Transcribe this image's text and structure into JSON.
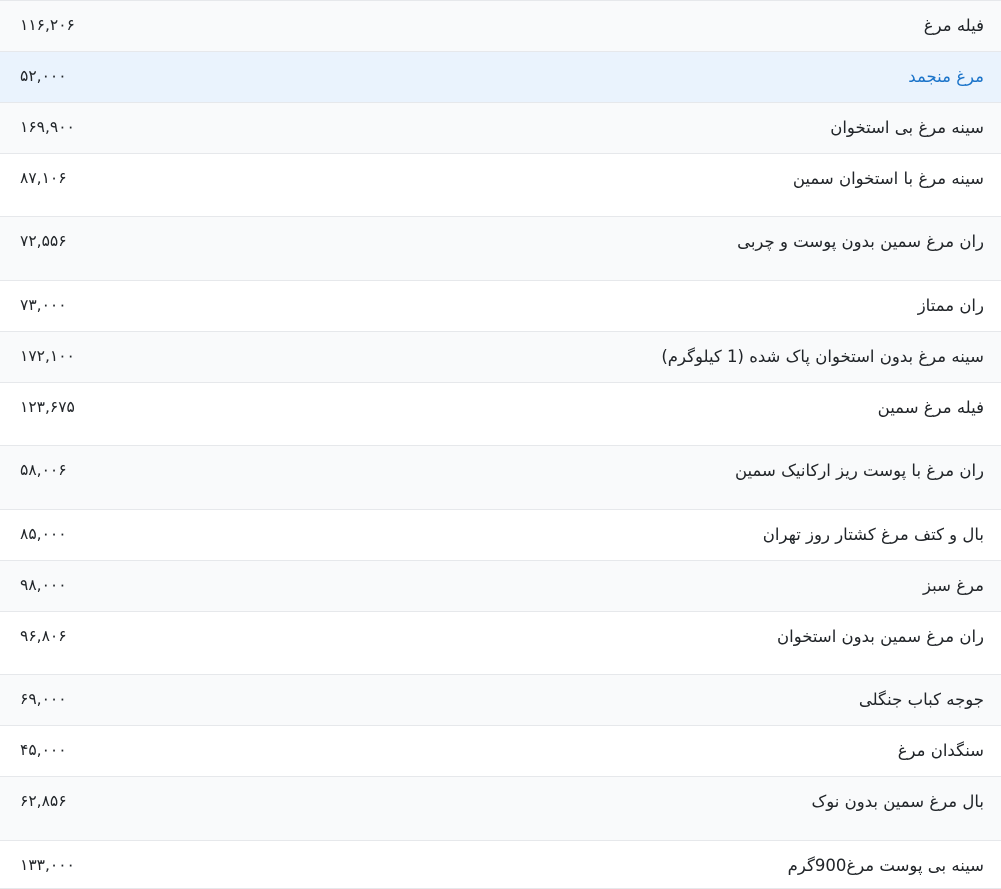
{
  "product_prices": {
    "rows": [
      {
        "name": "فیله مرغ",
        "price": "۱۱۶,۲۰۶",
        "state": "striped"
      },
      {
        "name": "مرغ منجمد",
        "price": "۵۲,۰۰۰",
        "state": "highlight"
      },
      {
        "name": "سینه مرغ بی استخوان",
        "price": "۱۶۹,۹۰۰",
        "state": "striped"
      },
      {
        "name": "سینه مرغ با استخوان سمین",
        "price": "۸۷,۱۰۶",
        "state": "plain"
      },
      {
        "name": "ران مرغ سمین بدون پوست و چربی",
        "price": "۷۲,۵۵۶",
        "state": "striped"
      },
      {
        "name": "ران ممتاز",
        "price": "۷۳,۰۰۰",
        "state": "plain"
      },
      {
        "name": "سینه مرغ بدون استخوان پاک شده (1 کیلوگرم)",
        "price": "۱۷۲,۱۰۰",
        "state": "striped"
      },
      {
        "name": "فیله مرغ سمین",
        "price": "۱۲۳,۶۷۵",
        "state": "plain"
      },
      {
        "name": "ران مرغ با پوست ریز ارکانیک سمین",
        "price": "۵۸,۰۰۶",
        "state": "striped"
      },
      {
        "name": "بال و کتف مرغ کشتار روز تهران",
        "price": "۸۵,۰۰۰",
        "state": "plain"
      },
      {
        "name": "مرغ سبز",
        "price": "۹۸,۰۰۰",
        "state": "striped"
      },
      {
        "name": "ران مرغ سمین بدون استخوان",
        "price": "۹۶,۸۰۶",
        "state": "plain"
      },
      {
        "name": "جوجه کباب جنگلی",
        "price": "۶۹,۰۰۰",
        "state": "striped"
      },
      {
        "name": "سنگدان مرغ",
        "price": "۴۵,۰۰۰",
        "state": "plain"
      },
      {
        "name": "بال مرغ سمین بدون نوک",
        "price": "۶۲,۸۵۶",
        "state": "striped"
      },
      {
        "name": "سینه بی پوست مرغ900گرم",
        "price": "۱۳۳,۰۰۰",
        "state": "plain"
      }
    ]
  }
}
